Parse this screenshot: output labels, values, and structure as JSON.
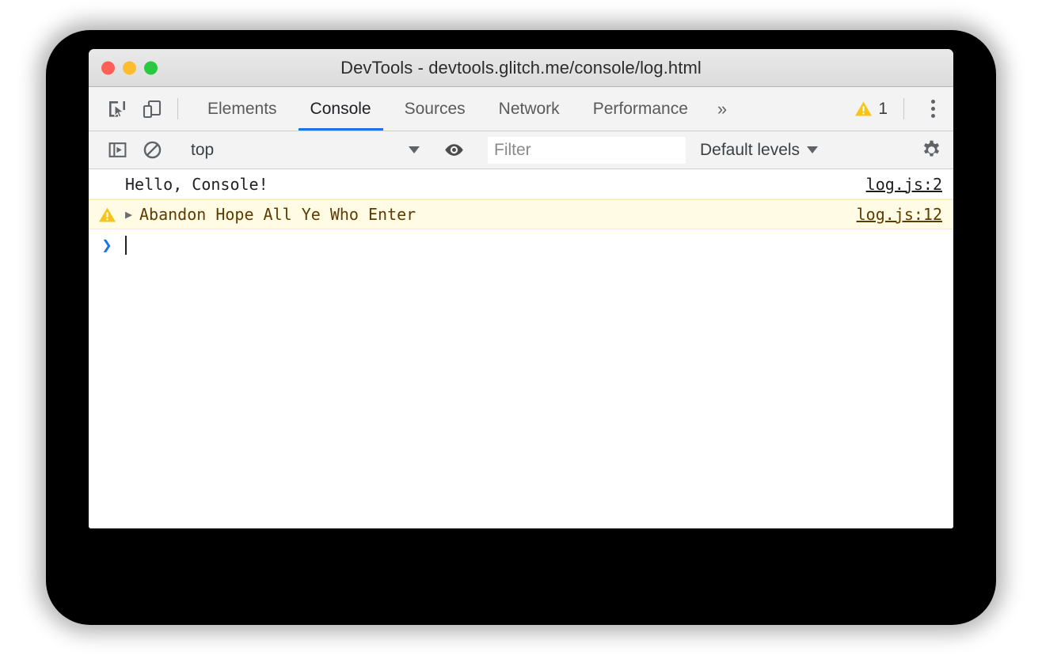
{
  "window": {
    "title": "DevTools - devtools.glitch.me/console/log.html",
    "traffic_lights": [
      {
        "name": "close",
        "color": "#ff5f57"
      },
      {
        "name": "minimize",
        "color": "#ffbd2e"
      },
      {
        "name": "maximize",
        "color": "#28c840"
      }
    ]
  },
  "tabbar": {
    "inspect_icon": "inspect-element-icon",
    "device_icon": "device-toolbar-icon",
    "tabs": [
      {
        "label": "Elements",
        "active": false
      },
      {
        "label": "Console",
        "active": true
      },
      {
        "label": "Sources",
        "active": false
      },
      {
        "label": "Network",
        "active": false
      },
      {
        "label": "Performance",
        "active": false
      }
    ],
    "overflow_label": "»",
    "warning_count": "1",
    "warning_icon": "warning-triangle-icon",
    "menu_icon": "kebab-menu-icon",
    "active_underline_color": "#1a73e8"
  },
  "console_toolbar": {
    "sidebar_icon": "show-console-sidebar-icon",
    "clear_icon": "clear-console-icon",
    "context": "top",
    "context_caret": "▼",
    "eye_icon": "live-expression-eye-icon",
    "filter_placeholder": "Filter",
    "filter_value": "",
    "levels_label": "Default levels",
    "levels_caret": "▼",
    "settings_icon": "settings-gear-icon"
  },
  "console": {
    "messages": [
      {
        "level": "log",
        "text": "Hello, Console!",
        "source": "log.js:2",
        "has_icon": false,
        "has_disclosure": false
      },
      {
        "level": "warning",
        "text": "Abandon Hope All Ye Who Enter",
        "source": "log.js:12",
        "has_icon": true,
        "has_disclosure": true,
        "disclosure_glyph": "▶",
        "icon": "warning-triangle-icon"
      }
    ],
    "prompt_glyph": "❯",
    "prompt_value": ""
  },
  "colors": {
    "accent_blue": "#1a73e8",
    "warning_bg": "#fffbe5",
    "warning_text": "#5c3c00",
    "warning_amber": "#f5c518",
    "chrome_gray": "#f3f3f3"
  }
}
